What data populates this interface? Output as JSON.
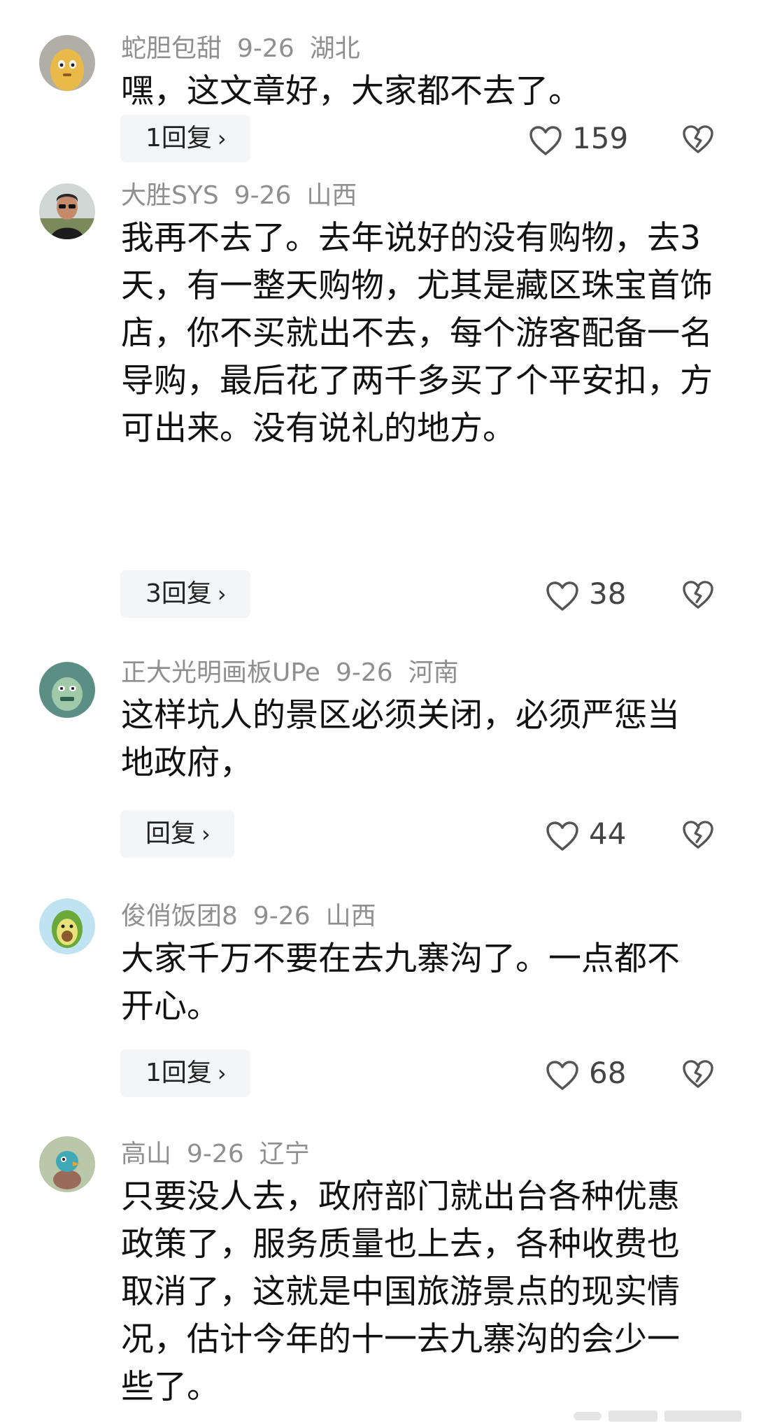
{
  "comments": [
    {
      "username": "蛇胆包甜",
      "date": "9-26",
      "location": "湖北",
      "text": "嘿，这文章好，大家都不去了。",
      "reply_label": "1回复",
      "likes": "159",
      "avatar_icon": "yellow-cartoon-avatar-icon"
    },
    {
      "username": "大胜SYS",
      "date": "9-26",
      "location": "山西",
      "text": "我再不去了。去年说好的没有购物，去3天，有一整天购物，尤其是藏区珠宝首饰店，你不买就出不去，每个游客配备一名导购，最后花了两千多买了个平安扣，方可出来。没有说礼的地方。",
      "reply_label": "3回复",
      "likes": "38",
      "avatar_icon": "man-with-sunglasses-avatar-icon"
    },
    {
      "username": "正大光明画板UPe",
      "date": "9-26",
      "location": "河南",
      "text": "这样坑人的景区必须关闭，必须严惩当地政府，",
      "reply_label": "回复",
      "likes": "44",
      "avatar_icon": "green-monster-avatar-icon"
    },
    {
      "username": "俊俏饭团8",
      "date": "9-26",
      "location": "山西",
      "text": "大家千万不要在去九寨沟了。一点都不开心。",
      "reply_label": "1回复",
      "likes": "68",
      "avatar_icon": "avocado-avatar-icon"
    },
    {
      "username": "高山",
      "date": "9-26",
      "location": "辽宁",
      "text": "只要没人去，政府部门就出台各种优惠政策了，服务质量也上去，各种收费也取消了，这就是中国旅游景点的现实情况，估计今年的十一去九寨沟的会少一些了。",
      "avatar_icon": "teal-bird-avatar-icon"
    }
  ],
  "icons": {
    "like": "heart-outline-icon",
    "dislike": "broken-heart-icon",
    "reply_chevron": "›"
  },
  "colors": {
    "meta_text": "#8f8f8f",
    "body_text": "#111111",
    "reply_bg": "#f4f5f7"
  }
}
